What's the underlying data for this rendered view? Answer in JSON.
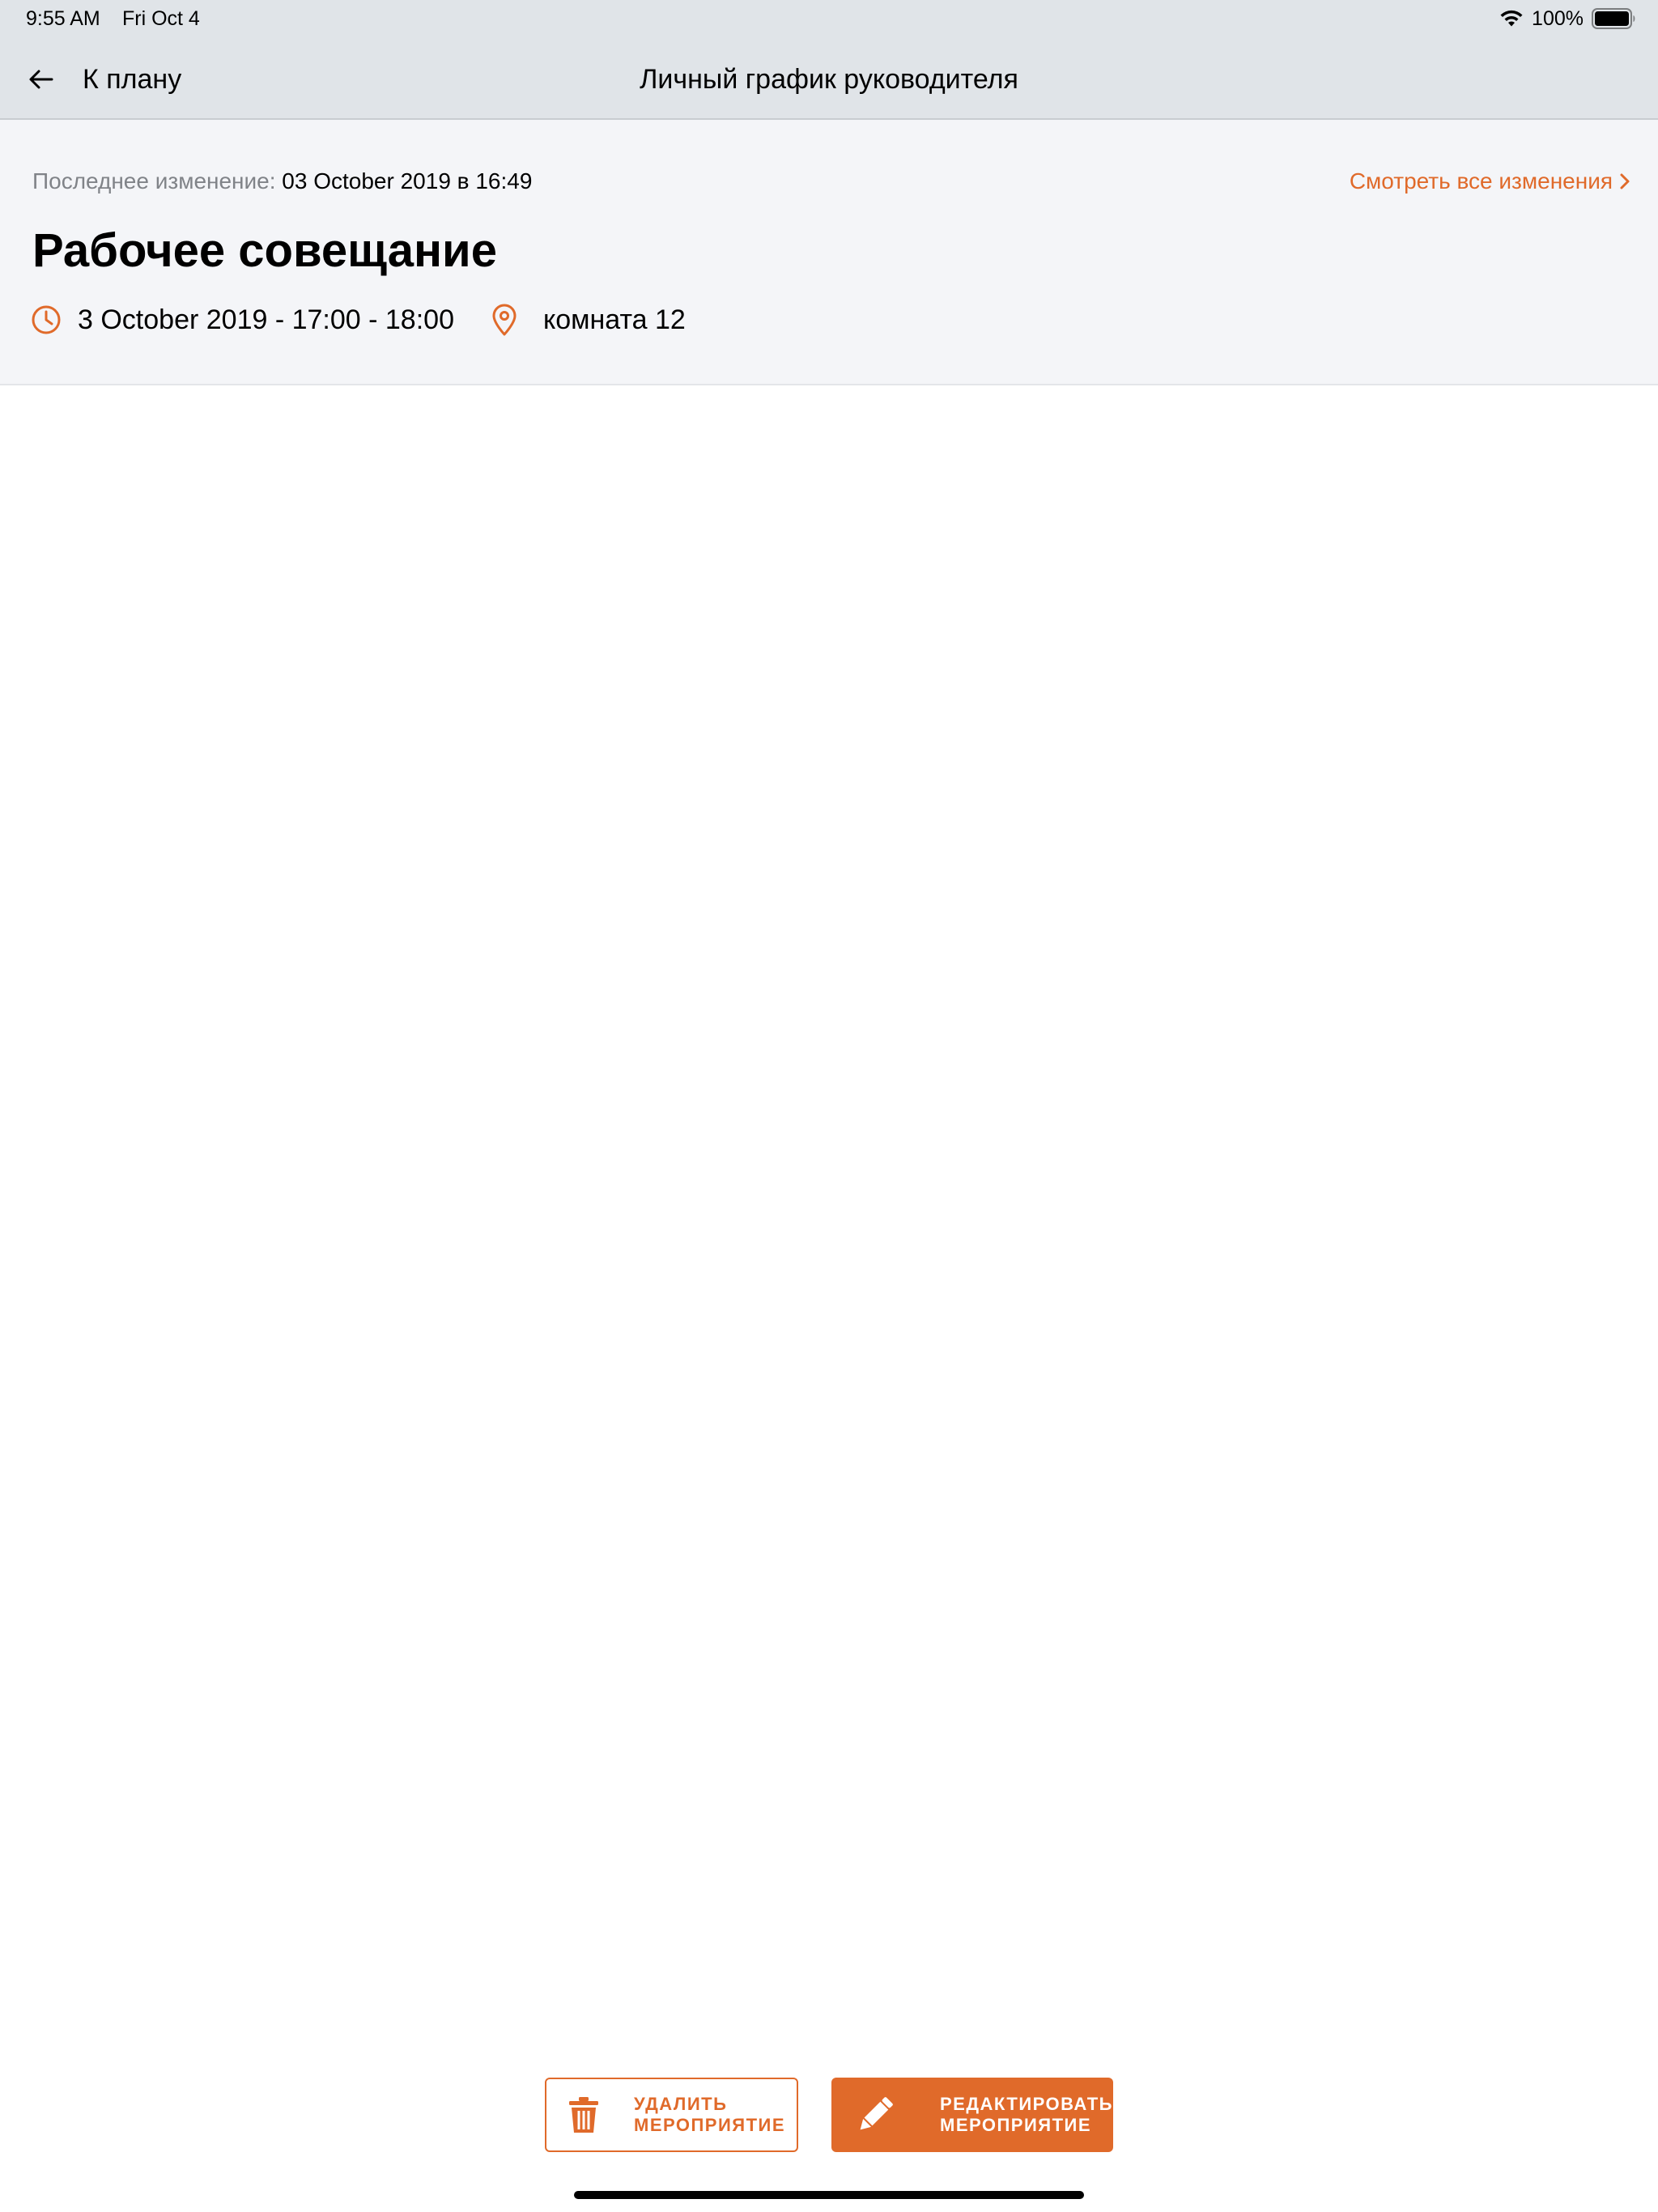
{
  "status_bar": {
    "time": "9:55 AM",
    "date": "Fri Oct 4",
    "battery": "100%",
    "icons": [
      "wifi-icon",
      "battery-icon"
    ]
  },
  "nav": {
    "back_label": "К плану",
    "back_icon": "arrow-left-icon",
    "title": "Личный график руководителя"
  },
  "event": {
    "last_change_label": "Последнее изменение:",
    "last_change_value": "03 October 2019 в 16:49",
    "view_changes_label": "Смотреть все изменения",
    "title": "Рабочее совещание",
    "time": "3 October 2019 - 17:00 - 18:00",
    "location": "комната 12"
  },
  "actions": {
    "delete_line1": "Удалить",
    "delete_line2": "мероприятие",
    "edit_line1": "Редактировать",
    "edit_line2": "мероприятие"
  },
  "colors": {
    "accent": "#e06a2a",
    "nav_background": "#e0e4e8",
    "panel_background": "#f4f5f8",
    "muted_text": "#808388"
  }
}
